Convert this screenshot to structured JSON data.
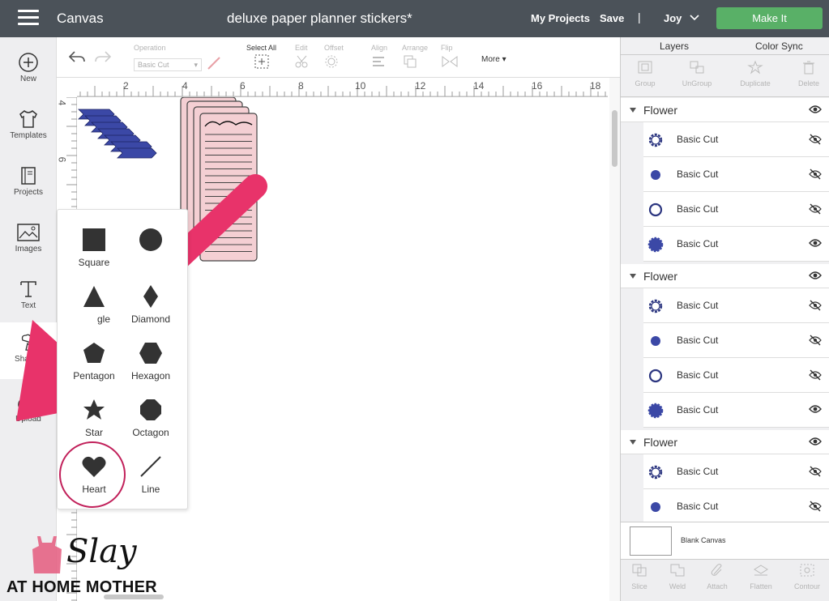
{
  "header": {
    "app_title": "Canvas",
    "doc_title": "deluxe paper planner stickers*",
    "my_projects": "My Projects",
    "save": "Save",
    "separator": "|",
    "user": "Joy",
    "make_it": "Make It"
  },
  "rail": {
    "new": "New",
    "templates": "Templates",
    "projects": "Projects",
    "images": "Images",
    "text": "Text",
    "shapes": "Shapes",
    "upload": "Upload"
  },
  "toolbar": {
    "operation_label": "Operation",
    "operation_value": "Basic Cut",
    "select_all": "Select All",
    "edit": "Edit",
    "offset": "Offset",
    "align": "Align",
    "arrange": "Arrange",
    "flip": "Flip",
    "more": "More"
  },
  "ruler_top": [
    "2",
    "4",
    "6",
    "8",
    "10",
    "12",
    "14",
    "16",
    "18"
  ],
  "ruler_left": [
    "4",
    "6"
  ],
  "shapes": {
    "square": "Square",
    "triangle_partial": "gle",
    "diamond": "Diamond",
    "pentagon": "Pentagon",
    "hexagon": "Hexagon",
    "star": "Star",
    "octagon": "Octagon",
    "heart": "Heart",
    "line": "Line"
  },
  "layers_panel": {
    "tab_layers": "Layers",
    "tab_color_sync": "Color Sync",
    "actions": {
      "group": "Group",
      "ungroup": "UnGroup",
      "duplicate": "Duplicate",
      "delete": "Delete"
    },
    "groups": [
      {
        "name": "Flower",
        "layers": [
          "Basic Cut",
          "Basic Cut",
          "Basic Cut",
          "Basic Cut"
        ]
      },
      {
        "name": "Flower",
        "layers": [
          "Basic Cut",
          "Basic Cut",
          "Basic Cut",
          "Basic Cut"
        ]
      },
      {
        "name": "Flower",
        "layers": [
          "Basic Cut",
          "Basic Cut"
        ]
      }
    ],
    "blank_canvas": "Blank Canvas",
    "bottom_actions": {
      "slice": "Slice",
      "weld": "Weld",
      "attach": "Attach",
      "flatten": "Flatten",
      "contour": "Contour"
    }
  },
  "logo": {
    "slay": "Slay",
    "subtitle": "AT HOME MOTHER"
  },
  "colors": {
    "header_bg": "#4b5259",
    "make_it_green": "#59b067",
    "arrow_pink": "#e8336a",
    "navy": "#3b48a6",
    "sticker_pink": "#f4cfd3"
  }
}
